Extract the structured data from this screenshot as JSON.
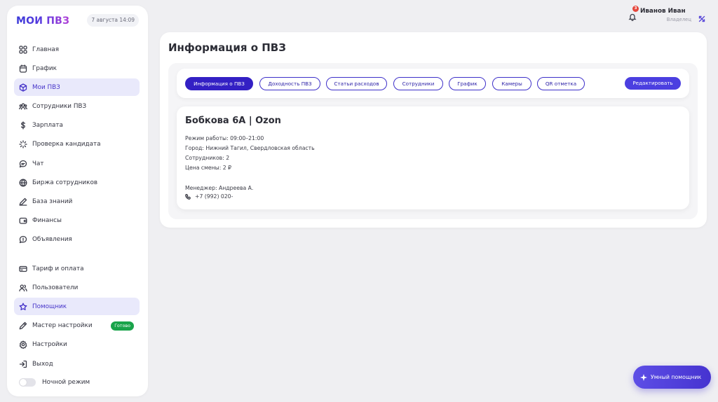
{
  "app": {
    "logo": "МОИ ПВЗ",
    "datetime": "7 августа 14:09"
  },
  "sidebar": {
    "items": [
      {
        "label": "Главная",
        "icon": "grid-icon"
      },
      {
        "label": "График",
        "icon": "calendar-icon"
      },
      {
        "label": "Мои ПВЗ",
        "icon": "box-icon",
        "active": true
      },
      {
        "label": "Сотрудники ПВЗ",
        "icon": "users-icon"
      },
      {
        "label": "Зарплата",
        "icon": "dollar-icon"
      },
      {
        "label": "Проверка кандидата",
        "icon": "loader-icon"
      },
      {
        "label": "Чат",
        "icon": "chat-icon"
      },
      {
        "label": "Биржа сотрудников",
        "icon": "globe-icon"
      },
      {
        "label": "База знаний",
        "icon": "pencil-icon"
      },
      {
        "label": "Финансы",
        "icon": "wallet-icon"
      },
      {
        "label": "Объявления",
        "icon": "megaphone-icon"
      }
    ],
    "bottom_items": [
      {
        "label": "Тариф и оплата",
        "icon": "card-icon"
      },
      {
        "label": "Пользователи",
        "icon": "user-group-icon"
      },
      {
        "label": "Помощник",
        "icon": "star-icon",
        "active": true
      },
      {
        "label": "Мастер настройки",
        "icon": "pen-icon",
        "badge": "Готово"
      },
      {
        "label": "Настройки",
        "icon": "gear-icon"
      },
      {
        "label": "Выход",
        "icon": "logout-icon"
      }
    ],
    "night_mode_label": "Ночной режим",
    "night_mode_on": false
  },
  "header": {
    "notifications_count": "3",
    "user_name": "Иванов Иван",
    "user_role": "Владелец"
  },
  "main": {
    "title": "Информация о ПВЗ",
    "tabs": [
      {
        "label": "Информация о ПВЗ",
        "active": true
      },
      {
        "label": "Доходность ПВЗ"
      },
      {
        "label": "Статьи расходов"
      },
      {
        "label": "Сотрудники"
      },
      {
        "label": "График"
      },
      {
        "label": "Камеры"
      },
      {
        "label": "QR отметка"
      }
    ],
    "edit_label": "Редактировать",
    "pvz": {
      "name": "Бобкова 6А | Ozon",
      "hours": "Режим работы: 09:00–21:00",
      "city": "Город: Нижний Тагил, Свердловская область",
      "employees": "Сотрудников: 2",
      "shift_price": "Цена смены: 2        ₽",
      "manager": "Менеджер: Андреева А.",
      "phone": "+7 (992) 020-"
    }
  },
  "assistant_button": "Умный помощник",
  "colors": {
    "accent": "#4634c9",
    "tab_active": "#3320c4",
    "ready_badge": "#19a34a",
    "notification": "#e5473d"
  }
}
